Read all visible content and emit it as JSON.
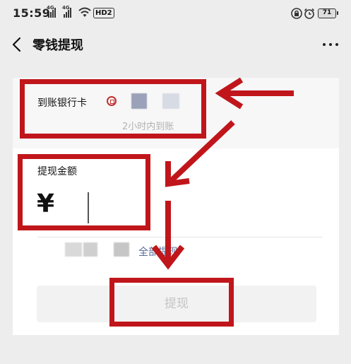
{
  "status_bar": {
    "time": "15:59",
    "signal_1": "4G",
    "signal_2": "4G",
    "hd_label": "HD2",
    "battery": "71"
  },
  "header": {
    "title": "零钱提现"
  },
  "bank_card": {
    "label": "到账银行卡",
    "arrival_note": "2小时内到账",
    "logo_color": "#c0312d"
  },
  "amount": {
    "label": "提现金额",
    "currency_symbol": "¥",
    "value": ""
  },
  "balance": {
    "withdraw_all_label": "全部提现"
  },
  "submit": {
    "label": "提现"
  },
  "colors": {
    "annotation_red": "#c0161b",
    "link_blue": "#576b95"
  },
  "icons": [
    "back-arrow-icon",
    "more-dots-icon",
    "bank-logo-icon",
    "wifi-icon",
    "lock-icon",
    "alarm-icon",
    "battery-icon"
  ]
}
